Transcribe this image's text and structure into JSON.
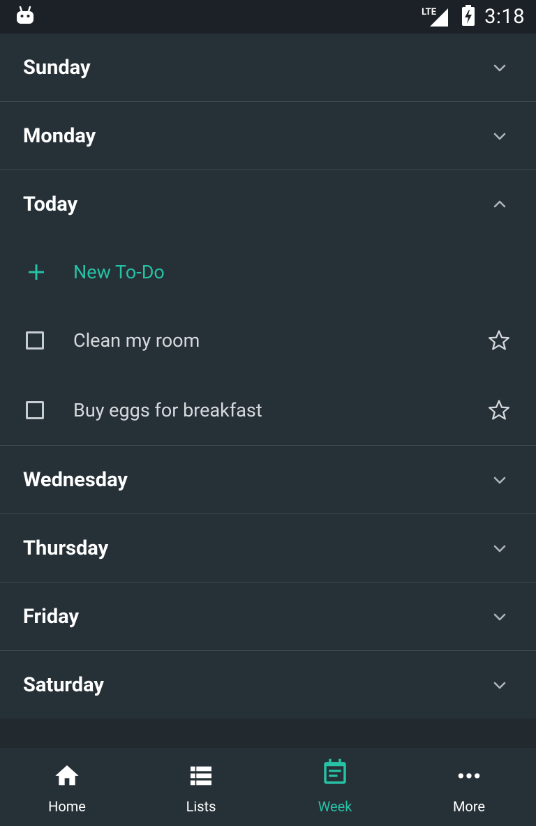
{
  "status_bar": {
    "network": "LTE",
    "time": "3:18"
  },
  "days": [
    {
      "label": "Sunday",
      "expanded": false
    },
    {
      "label": "Monday",
      "expanded": false
    },
    {
      "label": "Today",
      "expanded": true
    },
    {
      "label": "Wednesday",
      "expanded": false
    },
    {
      "label": "Thursday",
      "expanded": false
    },
    {
      "label": "Friday",
      "expanded": false
    },
    {
      "label": "Saturday",
      "expanded": false
    }
  ],
  "today": {
    "new_todo_label": "New To-Do",
    "todos": [
      {
        "text": "Clean my room",
        "checked": false,
        "starred": false
      },
      {
        "text": "Buy eggs for breakfast",
        "checked": false,
        "starred": false
      }
    ]
  },
  "bottom_nav": {
    "items": [
      {
        "label": "Home",
        "icon": "home-icon",
        "active": false
      },
      {
        "label": "Lists",
        "icon": "list-icon",
        "active": false
      },
      {
        "label": "Week",
        "icon": "calendar-icon",
        "active": true
      },
      {
        "label": "More",
        "icon": "more-horizontal-icon",
        "active": false
      }
    ]
  },
  "colors": {
    "accent": "#27c1a5",
    "background": "#263037",
    "status_bar": "#1b2126"
  }
}
